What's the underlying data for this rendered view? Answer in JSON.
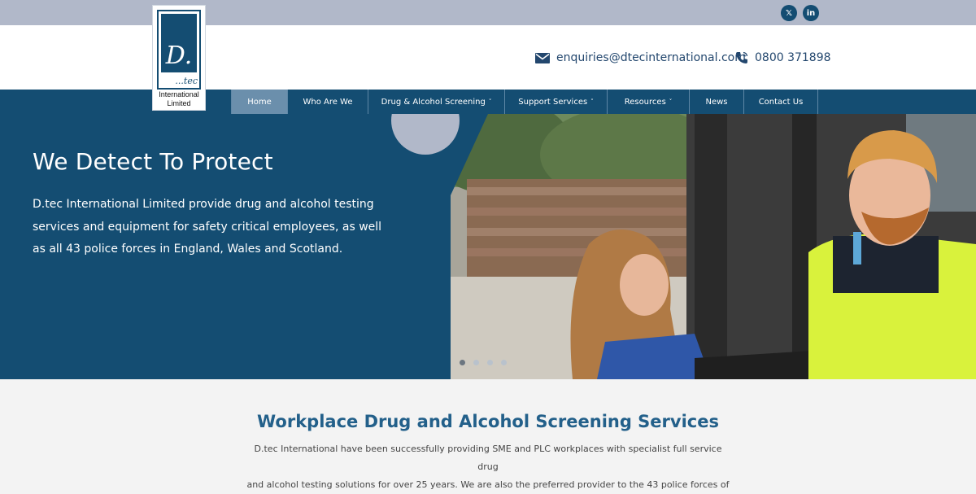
{
  "social": [
    {
      "icon": "x-icon",
      "glyph": "𝕏"
    },
    {
      "icon": "linkedin-icon",
      "glyph": "in"
    }
  ],
  "contact": {
    "email": "enquiries@dtecinternational.com",
    "phone": "0800 371898"
  },
  "logo": {
    "mark": "D.",
    "tec": "...tec",
    "line1": "International",
    "line2": "Limited"
  },
  "nav": [
    {
      "label": "Home",
      "active": true
    },
    {
      "label": "Who Are We"
    },
    {
      "label": "Drug & Alcohol Screening",
      "caret": "˅"
    },
    {
      "label": "Support Services",
      "caret": "˅"
    },
    {
      "label": "Resources",
      "caret": "˅"
    },
    {
      "label": "News"
    },
    {
      "label": "Contact Us"
    }
  ],
  "hero": {
    "title": "We Detect To Protect",
    "description": "D.tec International Limited provide drug and alcohol testing services and equipment for safety critical employees, as well as all 43 police forces in England, Wales and Scotland.",
    "slides": 4,
    "active_slide": 1
  },
  "section": {
    "title": "Workplace Drug and Alcohol Screening Services",
    "text_line1": "D.tec International have been successfully providing SME and PLC workplaces with specialist full service drug",
    "text_line2": "and alcohol testing solutions for over 25 years. We are also the preferred provider to the 43 police forces of"
  },
  "colors": {
    "brand_blue": "#144d72",
    "top_bar": "#b1b8c9",
    "active_nav": "#6b8fac",
    "heading_blue": "#23608a"
  }
}
